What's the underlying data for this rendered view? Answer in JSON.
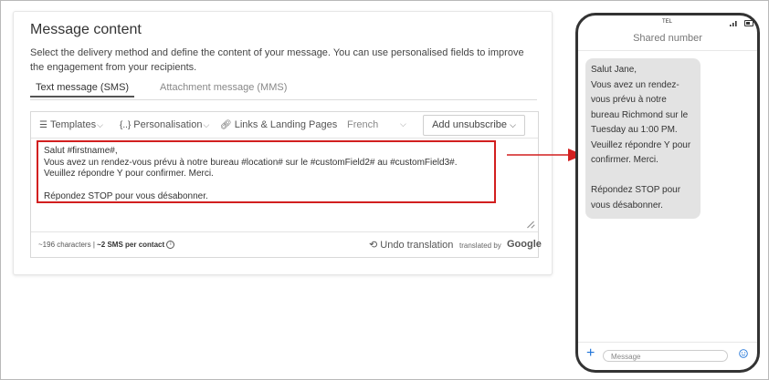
{
  "card": {
    "title": "Message content",
    "description": "Select the delivery method and define the content of your message. You can use personalised fields to improve the engagement from your recipients."
  },
  "tabs": [
    {
      "label": "Text message (SMS)",
      "active": true
    },
    {
      "label": "Attachment message (MMS)",
      "active": false
    }
  ],
  "toolbar": {
    "templates": "Templates",
    "personalisation": "Personalisation",
    "links": "Links & Landing Pages",
    "language": "French",
    "add_unsubscribe": "Add unsubscribe"
  },
  "message": {
    "text": "Salut #firstname#,\nVous avez un rendez-vous prévu à notre bureau #location# sur le #customField2# au #customField3#.\nVeuillez répondre Y pour confirmer. Merci.\n\nRépondez STOP pour vous désabonner."
  },
  "footer": {
    "chars": "~196 characters | ",
    "sms": "~2 SMS per contact",
    "undo": "Undo translation",
    "translated_by": "translated by",
    "google": "Google"
  },
  "phone": {
    "carrier": "TEL",
    "header": "Shared number",
    "bubble": "Salut Jane,\nVous avez un rendez-vous prévu à notre bureau Richmond sur le Tuesday au 1:00 PM.\nVeuillez répondre Y pour confirmer. Merci.\n\nRépondez STOP pour vous désabonner.",
    "input_placeholder": "Message"
  },
  "colors": {
    "highlight": "#d21f1f",
    "accent": "#1e73d8"
  },
  "icons": [
    "template-icon",
    "personalisation-icon",
    "link-icon",
    "chevron-down-icon",
    "info-icon",
    "undo-icon",
    "plus-icon",
    "emoji-icon",
    "signal-icon",
    "battery-icon",
    "arrow-icon"
  ]
}
